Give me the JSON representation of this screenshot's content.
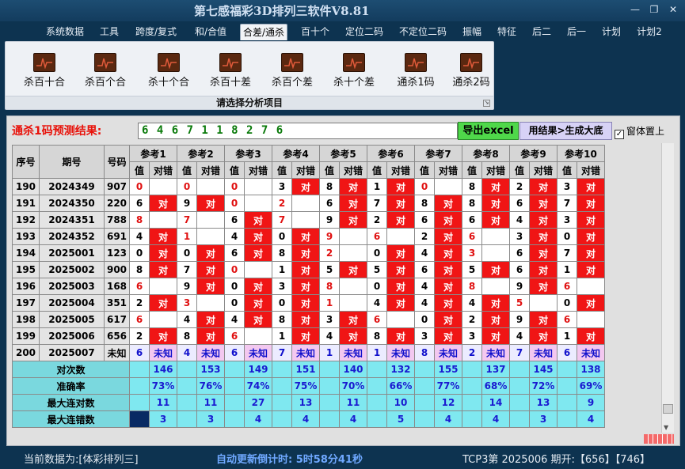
{
  "window": {
    "title": "第七感福彩3D排列三软件V8.81"
  },
  "menu": [
    "系统数据",
    "工具",
    "跨度/复式",
    "和/合值",
    "合差/通杀",
    "百十个",
    "定位二码",
    "不定位二码",
    "振幅",
    "特征",
    "后二",
    "后一",
    "计划",
    "计划2"
  ],
  "active_menu": "合差/通杀",
  "ribbon": {
    "buttons": [
      "杀百十合",
      "杀百个合",
      "杀十个合",
      "杀百十差",
      "杀百个差",
      "杀十个差",
      "通杀1码",
      "通杀2码"
    ],
    "footer": "请选择分析项目"
  },
  "prediction": {
    "label": "通杀1码预测结果:",
    "value": "6 4 6 7 1 1 8 2 7 6",
    "export_button": "导出excel",
    "generate_button": "用结果>生成大底",
    "topmost_label": "窗体置上",
    "topmost_checked": true
  },
  "table": {
    "headers": {
      "seq": "序号",
      "issue": "期号",
      "number": "号码",
      "value": "值",
      "hit": "对错"
    },
    "refs": [
      "参考1",
      "参考2",
      "参考3",
      "参考4",
      "参考5",
      "参考6",
      "参考7",
      "参考8",
      "参考9",
      "参考10"
    ],
    "rows": [
      {
        "seq": "190",
        "issue": "2024349",
        "num": "907",
        "cells": [
          [
            "0",
            false,
            true
          ],
          [
            "0",
            false,
            true
          ],
          [
            "0",
            false,
            true
          ],
          [
            "3",
            true,
            false
          ],
          [
            "8",
            true,
            false
          ],
          [
            "1",
            true,
            false
          ],
          [
            "0",
            false,
            true
          ],
          [
            "8",
            true,
            false
          ],
          [
            "2",
            true,
            false
          ],
          [
            "3",
            true,
            false
          ]
        ]
      },
      {
        "seq": "191",
        "issue": "2024350",
        "num": "220",
        "cells": [
          [
            "6",
            true,
            false
          ],
          [
            "9",
            true,
            false
          ],
          [
            "0",
            false,
            true
          ],
          [
            "2",
            false,
            true
          ],
          [
            "6",
            true,
            false
          ],
          [
            "7",
            true,
            false
          ],
          [
            "8",
            true,
            false
          ],
          [
            "8",
            true,
            false
          ],
          [
            "6",
            true,
            false
          ],
          [
            "7",
            true,
            false
          ]
        ]
      },
      {
        "seq": "192",
        "issue": "2024351",
        "num": "788",
        "cells": [
          [
            "8",
            false,
            true
          ],
          [
            "7",
            false,
            true
          ],
          [
            "6",
            true,
            false
          ],
          [
            "7",
            false,
            true
          ],
          [
            "9",
            true,
            false
          ],
          [
            "2",
            true,
            false
          ],
          [
            "6",
            true,
            false
          ],
          [
            "6",
            true,
            false
          ],
          [
            "4",
            true,
            false
          ],
          [
            "3",
            true,
            false
          ]
        ]
      },
      {
        "seq": "193",
        "issue": "2024352",
        "num": "691",
        "cells": [
          [
            "4",
            true,
            false
          ],
          [
            "1",
            false,
            true
          ],
          [
            "4",
            true,
            false
          ],
          [
            "0",
            true,
            false
          ],
          [
            "9",
            false,
            true
          ],
          [
            "6",
            false,
            true
          ],
          [
            "2",
            true,
            false
          ],
          [
            "6",
            false,
            true
          ],
          [
            "3",
            true,
            false
          ],
          [
            "0",
            true,
            false
          ]
        ]
      },
      {
        "seq": "194",
        "issue": "2025001",
        "num": "123",
        "cells": [
          [
            "0",
            true,
            false
          ],
          [
            "0",
            true,
            false
          ],
          [
            "6",
            true,
            false
          ],
          [
            "8",
            true,
            false
          ],
          [
            "2",
            false,
            true
          ],
          [
            "0",
            true,
            false
          ],
          [
            "4",
            true,
            false
          ],
          [
            "3",
            false,
            true
          ],
          [
            "6",
            true,
            false
          ],
          [
            "7",
            true,
            false
          ]
        ]
      },
      {
        "seq": "195",
        "issue": "2025002",
        "num": "900",
        "cells": [
          [
            "8",
            true,
            false
          ],
          [
            "7",
            true,
            false
          ],
          [
            "0",
            false,
            true
          ],
          [
            "1",
            true,
            false
          ],
          [
            "5",
            true,
            false
          ],
          [
            "5",
            true,
            false
          ],
          [
            "6",
            true,
            false
          ],
          [
            "5",
            true,
            false
          ],
          [
            "6",
            true,
            false
          ],
          [
            "1",
            true,
            false
          ]
        ]
      },
      {
        "seq": "196",
        "issue": "2025003",
        "num": "168",
        "cells": [
          [
            "6",
            false,
            true
          ],
          [
            "9",
            true,
            false
          ],
          [
            "0",
            true,
            false
          ],
          [
            "3",
            true,
            false
          ],
          [
            "8",
            false,
            true
          ],
          [
            "0",
            true,
            false
          ],
          [
            "4",
            true,
            false
          ],
          [
            "8",
            false,
            true
          ],
          [
            "9",
            true,
            false
          ],
          [
            "6",
            false,
            true
          ]
        ]
      },
      {
        "seq": "197",
        "issue": "2025004",
        "num": "351",
        "cells": [
          [
            "2",
            true,
            false
          ],
          [
            "3",
            false,
            true
          ],
          [
            "0",
            true,
            false
          ],
          [
            "0",
            true,
            false
          ],
          [
            "1",
            false,
            true
          ],
          [
            "4",
            true,
            false
          ],
          [
            "4",
            true,
            false
          ],
          [
            "4",
            true,
            false
          ],
          [
            "5",
            false,
            true
          ],
          [
            "0",
            true,
            false
          ]
        ]
      },
      {
        "seq": "198",
        "issue": "2025005",
        "num": "617",
        "cells": [
          [
            "6",
            false,
            true
          ],
          [
            "4",
            true,
            false
          ],
          [
            "4",
            true,
            false
          ],
          [
            "8",
            true,
            false
          ],
          [
            "3",
            true,
            false
          ],
          [
            "6",
            false,
            true
          ],
          [
            "0",
            true,
            false
          ],
          [
            "2",
            true,
            false
          ],
          [
            "9",
            true,
            false
          ],
          [
            "6",
            false,
            true
          ]
        ]
      },
      {
        "seq": "199",
        "issue": "2025006",
        "num": "656",
        "cells": [
          [
            "2",
            true,
            false
          ],
          [
            "8",
            true,
            false
          ],
          [
            "6",
            false,
            true
          ],
          [
            "1",
            true,
            false
          ],
          [
            "4",
            true,
            false
          ],
          [
            "8",
            true,
            false
          ],
          [
            "3",
            true,
            false
          ],
          [
            "3",
            true,
            false
          ],
          [
            "4",
            true,
            false
          ],
          [
            "1",
            true,
            false
          ]
        ]
      }
    ],
    "hit_text": "对",
    "pending": {
      "seq": "200",
      "issue": "2025007",
      "num": "未知",
      "values": [
        "6",
        "4",
        "6",
        "7",
        "1",
        "1",
        "8",
        "2",
        "7",
        "6"
      ],
      "status": "未知"
    },
    "summary": [
      {
        "label": "对次数",
        "values": [
          "146",
          "153",
          "149",
          "151",
          "140",
          "132",
          "155",
          "137",
          "145",
          "138"
        ]
      },
      {
        "label": "准确率",
        "values": [
          "73%",
          "76%",
          "74%",
          "75%",
          "70%",
          "66%",
          "77%",
          "68%",
          "72%",
          "69%"
        ]
      },
      {
        "label": "最大连对数",
        "values": [
          "11",
          "11",
          "27",
          "13",
          "11",
          "10",
          "12",
          "14",
          "13",
          "9"
        ]
      },
      {
        "label": "最大连错数",
        "values": [
          "3",
          "3",
          "4",
          "4",
          "4",
          "5",
          "4",
          "4",
          "3",
          "4"
        ]
      }
    ]
  },
  "status": {
    "current_data": "当前数据为:[体彩排列三]",
    "countdown": "自动更新倒计时: 5时58分41秒",
    "draw_info": "TCP3第 2025006 期开:【656】【746】"
  },
  "colors": {
    "hit": "#f01515",
    "miss_value": "#e01010",
    "summary_bg": "#7fe8f0",
    "summary_text": "#1a1ad0",
    "excel_button": "#4fd84a",
    "generate_button": "#d7d2f6"
  }
}
